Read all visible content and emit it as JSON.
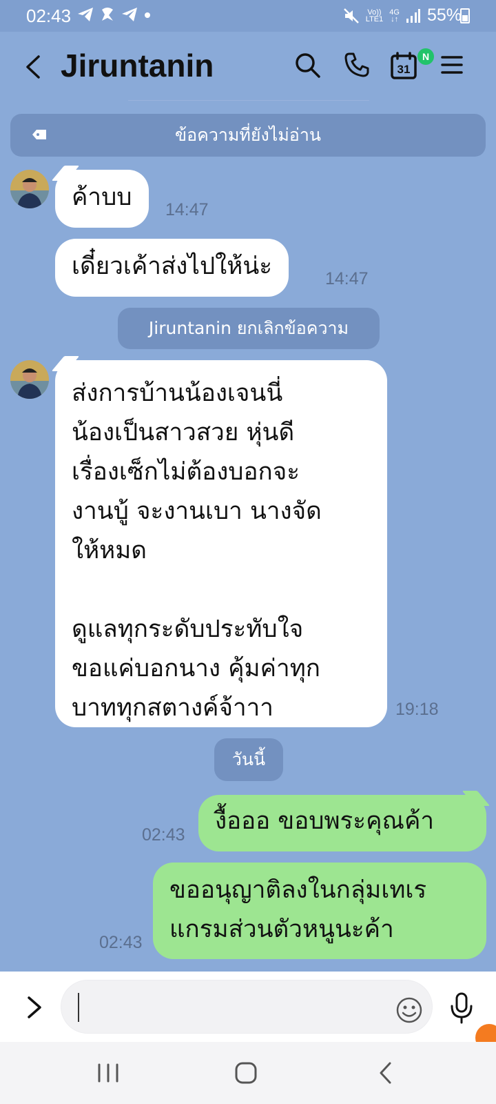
{
  "status": {
    "time": "02:43",
    "network": "4G",
    "volte_top": "Vo))",
    "volte_bottom": "LTE1",
    "battery": "55%"
  },
  "header": {
    "title": "Jiruntanin",
    "calendar_day": "31",
    "calendar_badge": "N"
  },
  "unread_banner": "ข้อความที่ยังไม่อ่าน",
  "messages": [
    {
      "text": "ค้าบบ",
      "time": "14:47"
    },
    {
      "text": "เดี๋ยวเค้าส่งไปให้น่ะ",
      "time": "14:47"
    },
    {
      "text": "ส่งการบ้านน้องเจนนี่\nน้องเป็นสาวสวย หุ่นดี\nเรื่องเซ็กไม่ต้องบอกจะ\nงานบู้ จะงานเบา นางจัด\nให้หมด\n\nดูแลทุกระดับประทับใจ\nขอแค่บอกนาง คุ้มค่าทุก\nบาททุกสตางค์จ้าาา",
      "time": "19:18"
    },
    {
      "text": "งื้อออ ขอบพระคุณค้า",
      "time": "02:43"
    },
    {
      "text": "ขออนุญาติลงในกลุ่มเทเร\nแกรมส่วนตัวหนูนะค้า",
      "time": "02:43"
    }
  ],
  "system": {
    "unsent": "Jiruntanin ยกเลิกข้อความ",
    "today": "วันนี้"
  },
  "colors": {
    "chat_bg": "#8aaad8",
    "incoming_bubble": "#ffffff",
    "outgoing_bubble": "#9de591",
    "system_pill": "#7391c0"
  }
}
